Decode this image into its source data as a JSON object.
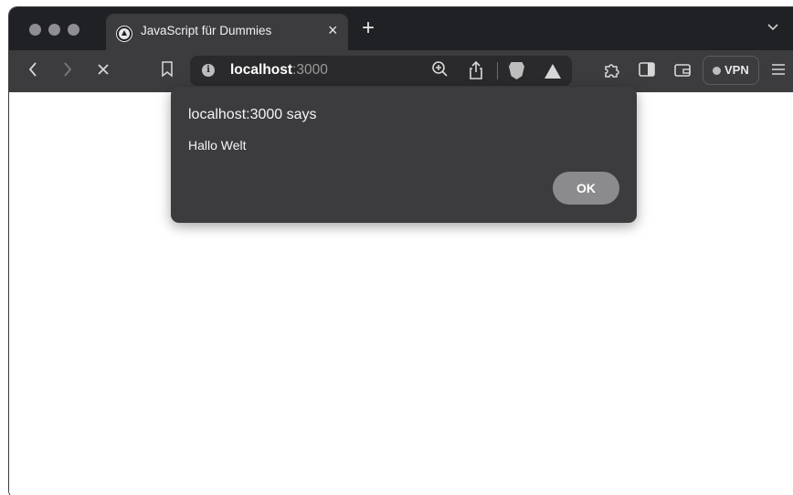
{
  "tab": {
    "title": "JavaScript für Dummies",
    "close_glyph": "×",
    "new_tab_glyph": "+",
    "tab_list_glyph": "⌄"
  },
  "toolbar": {
    "back_glyph": "‹",
    "forward_glyph": "›",
    "stop_glyph": "×",
    "bookmark_icon": "bookmark-icon",
    "url_host": "localhost",
    "url_port": ":3000",
    "info_glyph": "i",
    "vpn_label": "VPN",
    "menu_glyph": "≡"
  },
  "dialog": {
    "title": "localhost:3000 says",
    "message": "Hallo Welt",
    "ok_label": "OK"
  },
  "colors": {
    "tab_bar": "#202124",
    "toolbar": "#3c3c3f",
    "dialog": "#3c3c3f",
    "ok_button": "#8b8b8e"
  }
}
